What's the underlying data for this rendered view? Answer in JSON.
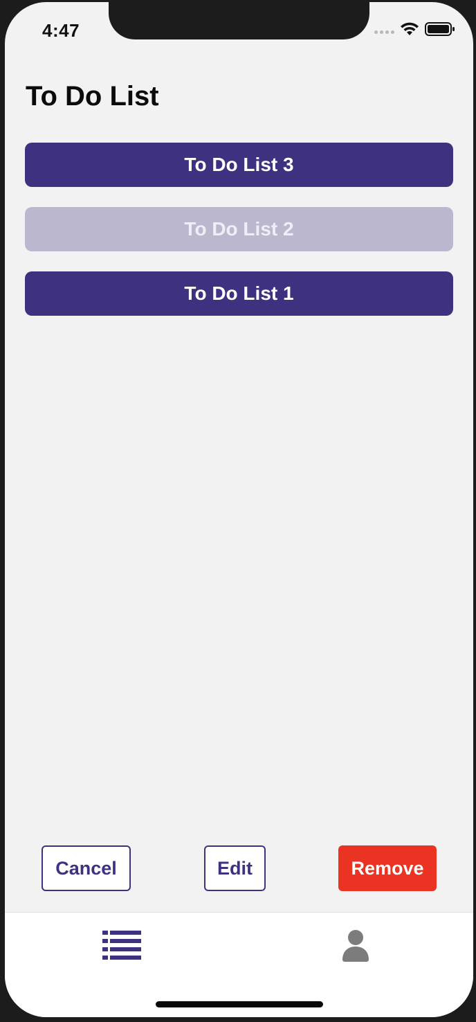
{
  "status_bar": {
    "time": "4:47"
  },
  "header": {
    "title": "To Do List"
  },
  "lists": [
    {
      "label": "To Do List 3",
      "state": "active"
    },
    {
      "label": "To Do List 2",
      "state": "selected-faded"
    },
    {
      "label": "To Do List 1",
      "state": "active"
    }
  ],
  "actions": {
    "cancel_label": "Cancel",
    "edit_label": "Edit",
    "remove_label": "Remove"
  },
  "tab_bar": {
    "tabs": [
      {
        "icon": "list-icon",
        "active": true
      },
      {
        "icon": "person-icon",
        "active": false
      }
    ]
  },
  "colors": {
    "accent": "#3d3180",
    "accent_faded": "#bbb7cf",
    "danger": "#ea3323",
    "background": "#f2f2f3",
    "inactive_icon": "#7c7c7c"
  }
}
